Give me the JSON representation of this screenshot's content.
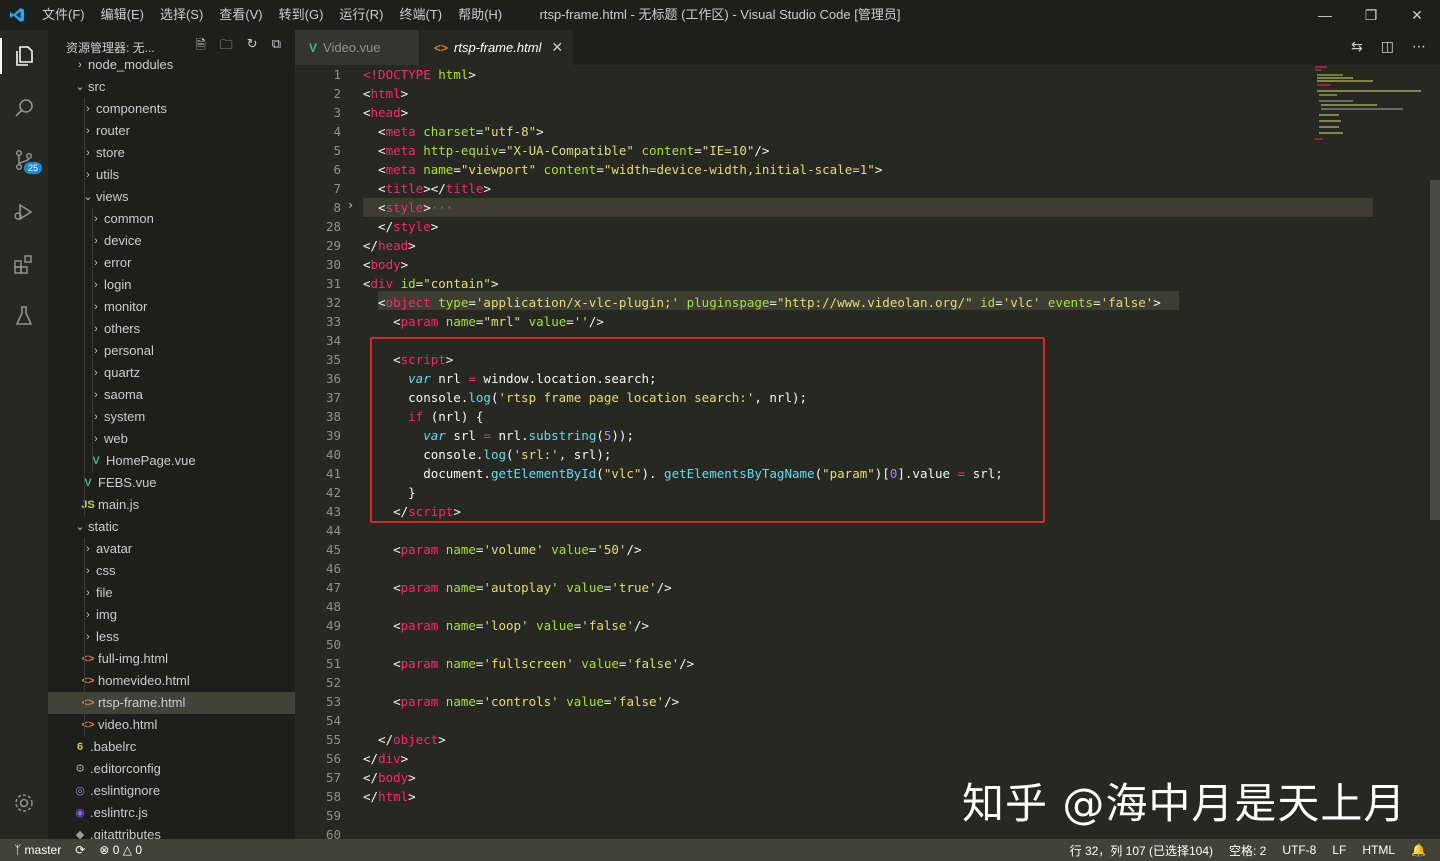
{
  "titlebar": {
    "menu": [
      "文件(F)",
      "编辑(E)",
      "选择(S)",
      "查看(V)",
      "转到(G)",
      "运行(R)",
      "终端(T)",
      "帮助(H)"
    ],
    "title": "rtsp-frame.html - 无标题 (工作区) - Visual Studio Code [管理员]"
  },
  "activity_bar": {
    "scm_badge": "25"
  },
  "sidebar": {
    "title": "资源管理器: 无...",
    "items": [
      {
        "label": "node_modules",
        "indent": 1,
        "type": "folder",
        "open": false
      },
      {
        "label": "src",
        "indent": 1,
        "type": "folder",
        "open": true
      },
      {
        "label": "components",
        "indent": 2,
        "type": "folder",
        "open": false
      },
      {
        "label": "router",
        "indent": 2,
        "type": "folder",
        "open": false
      },
      {
        "label": "store",
        "indent": 2,
        "type": "folder",
        "open": false
      },
      {
        "label": "utils",
        "indent": 2,
        "type": "folder",
        "open": false
      },
      {
        "label": "views",
        "indent": 2,
        "type": "folder",
        "open": true
      },
      {
        "label": "common",
        "indent": 3,
        "type": "folder",
        "open": false
      },
      {
        "label": "device",
        "indent": 3,
        "type": "folder",
        "open": false
      },
      {
        "label": "error",
        "indent": 3,
        "type": "folder",
        "open": false
      },
      {
        "label": "login",
        "indent": 3,
        "type": "folder",
        "open": false
      },
      {
        "label": "monitor",
        "indent": 3,
        "type": "folder",
        "open": false
      },
      {
        "label": "others",
        "indent": 3,
        "type": "folder",
        "open": false
      },
      {
        "label": "personal",
        "indent": 3,
        "type": "folder",
        "open": false
      },
      {
        "label": "quartz",
        "indent": 3,
        "type": "folder",
        "open": false
      },
      {
        "label": "saoma",
        "indent": 3,
        "type": "folder",
        "open": false
      },
      {
        "label": "system",
        "indent": 3,
        "type": "folder",
        "open": false
      },
      {
        "label": "web",
        "indent": 3,
        "type": "folder",
        "open": false
      },
      {
        "label": "HomePage.vue",
        "indent": 3,
        "type": "vue"
      },
      {
        "label": "FEBS.vue",
        "indent": 2,
        "type": "vue"
      },
      {
        "label": "main.js",
        "indent": 2,
        "type": "js"
      },
      {
        "label": "static",
        "indent": 1,
        "type": "folder",
        "open": true
      },
      {
        "label": "avatar",
        "indent": 2,
        "type": "folder",
        "open": false
      },
      {
        "label": "css",
        "indent": 2,
        "type": "folder",
        "open": false
      },
      {
        "label": "file",
        "indent": 2,
        "type": "folder",
        "open": false
      },
      {
        "label": "img",
        "indent": 2,
        "type": "folder",
        "open": false
      },
      {
        "label": "less",
        "indent": 2,
        "type": "folder",
        "open": false
      },
      {
        "label": "full-img.html",
        "indent": 2,
        "type": "html"
      },
      {
        "label": "homevideo.html",
        "indent": 2,
        "type": "html"
      },
      {
        "label": "rtsp-frame.html",
        "indent": 2,
        "type": "html",
        "selected": true
      },
      {
        "label": "video.html",
        "indent": 2,
        "type": "html"
      },
      {
        "label": ".babelrc",
        "indent": 1,
        "type": "babel"
      },
      {
        "label": ".editorconfig",
        "indent": 1,
        "type": "gear"
      },
      {
        "label": ".eslintignore",
        "indent": 1,
        "type": "eslint"
      },
      {
        "label": ".eslintrc.js",
        "indent": 1,
        "type": "eslintjs"
      },
      {
        "label": ".gitattributes",
        "indent": 1,
        "type": "git"
      }
    ]
  },
  "tabs": [
    {
      "label": "Video.vue",
      "type": "vue",
      "active": false
    },
    {
      "label": "rtsp-frame.html",
      "type": "html",
      "active": true
    }
  ],
  "editor": {
    "line_numbers": [
      "1",
      "2",
      "3",
      "4",
      "5",
      "6",
      "7",
      "8",
      "28",
      "29",
      "30",
      "31",
      "32",
      "33",
      "34",
      "35",
      "36",
      "37",
      "38",
      "39",
      "40",
      "41",
      "42",
      "43",
      "44",
      "45",
      "46",
      "47",
      "48",
      "49",
      "50",
      "51",
      "52",
      "53",
      "54",
      "55",
      "56",
      "57",
      "58",
      "59",
      "60"
    ],
    "lines": [
      [
        [
          "k",
          "<!DOCTYPE"
        ],
        [
          "a",
          " html"
        ],
        [
          "",
          "&gt;"
        ]
      ],
      [
        [
          "",
          "&lt;"
        ],
        [
          "k",
          "html"
        ],
        [
          "",
          "&gt;"
        ]
      ],
      [
        [
          "",
          "&lt;"
        ],
        [
          "k",
          "head"
        ],
        [
          "",
          "&gt;"
        ]
      ],
      [
        [
          "",
          "  &lt;"
        ],
        [
          "k",
          "meta"
        ],
        [
          "a",
          " charset"
        ],
        [
          "",
          "="
        ],
        [
          "s",
          "\"utf-8\""
        ],
        [
          "",
          "&gt;"
        ]
      ],
      [
        [
          "",
          "  &lt;"
        ],
        [
          "k",
          "meta"
        ],
        [
          "a",
          " http-equiv"
        ],
        [
          "",
          "="
        ],
        [
          "s",
          "\"X-UA-Compatible\""
        ],
        [
          "a",
          " content"
        ],
        [
          "",
          "="
        ],
        [
          "s",
          "\"IE=10\""
        ],
        [
          "",
          "/&gt;"
        ]
      ],
      [
        [
          "",
          "  &lt;"
        ],
        [
          "k",
          "meta"
        ],
        [
          "a",
          " name"
        ],
        [
          "",
          "="
        ],
        [
          "s",
          "\"viewport\""
        ],
        [
          "a",
          " content"
        ],
        [
          "",
          "="
        ],
        [
          "s",
          "\"width=device-width,initial-scale=1\""
        ],
        [
          "",
          "&gt;"
        ]
      ],
      [
        [
          "",
          "  &lt;"
        ],
        [
          "k",
          "title"
        ],
        [
          "",
          "&gt;&lt;/"
        ],
        [
          "k",
          "title"
        ],
        [
          "",
          "&gt;"
        ]
      ],
      [
        [
          "",
          "  &lt;"
        ],
        [
          "k",
          "style"
        ],
        [
          "",
          "&gt;"
        ],
        [
          "d",
          "···"
        ]
      ],
      [
        [
          "",
          "  &lt;/"
        ],
        [
          "k",
          "style"
        ],
        [
          "",
          "&gt;"
        ]
      ],
      [
        [
          "",
          "&lt;/"
        ],
        [
          "k",
          "head"
        ],
        [
          "",
          "&gt;"
        ]
      ],
      [
        [
          "",
          "&lt;"
        ],
        [
          "k",
          "body"
        ],
        [
          "",
          "&gt;"
        ]
      ],
      [
        [
          "",
          "&lt;"
        ],
        [
          "k",
          "div"
        ],
        [
          "a",
          " id"
        ],
        [
          "",
          "="
        ],
        [
          "s",
          "\"contain\""
        ],
        [
          "",
          "&gt;"
        ]
      ],
      [
        [
          "",
          "  &lt;"
        ],
        [
          "k",
          "object"
        ],
        [
          "a",
          " type"
        ],
        [
          "",
          "="
        ],
        [
          "s",
          "'application/x-vlc-plugin;'"
        ],
        [
          "a",
          " pluginspage"
        ],
        [
          "",
          "="
        ],
        [
          "s",
          "\"http://www.videolan.org/\""
        ],
        [
          "a",
          " id"
        ],
        [
          "",
          "="
        ],
        [
          "s",
          "'vlc'"
        ],
        [
          "a",
          " events"
        ],
        [
          "",
          "="
        ],
        [
          "s",
          "'false'"
        ],
        [
          "",
          "&gt;"
        ]
      ],
      [
        [
          "",
          "    &lt;"
        ],
        [
          "k",
          "param"
        ],
        [
          "a",
          " name"
        ],
        [
          "",
          "="
        ],
        [
          "s",
          "\"mrl\""
        ],
        [
          "a",
          " value"
        ],
        [
          "",
          "="
        ],
        [
          "s",
          "''"
        ],
        [
          "",
          "/&gt;"
        ]
      ],
      [],
      [
        [
          "",
          "    &lt;"
        ],
        [
          "k",
          "script"
        ],
        [
          "",
          "&gt;"
        ]
      ],
      [
        [
          "",
          "      "
        ],
        [
          "v",
          "var"
        ],
        [
          "",
          " nrl "
        ],
        [
          "k",
          "="
        ],
        [
          "",
          " window.location.search;"
        ]
      ],
      [
        [
          "",
          "      console."
        ],
        [
          "f",
          "log"
        ],
        [
          "",
          "("
        ],
        [
          "s",
          "'rtsp frame page location search:'"
        ],
        [
          "",
          ", nrl);"
        ]
      ],
      [
        [
          "",
          "      "
        ],
        [
          "k",
          "if"
        ],
        [
          "",
          " (nrl) {"
        ]
      ],
      [
        [
          "",
          "        "
        ],
        [
          "v",
          "var"
        ],
        [
          "",
          " srl "
        ],
        [
          "k",
          "="
        ],
        [
          "",
          " nrl."
        ],
        [
          "f",
          "substring"
        ],
        [
          "",
          "("
        ],
        [
          "n",
          "5"
        ],
        [
          "",
          "));"
        ]
      ],
      [
        [
          "",
          "        console."
        ],
        [
          "f",
          "log"
        ],
        [
          "",
          "("
        ],
        [
          "s",
          "'srl:'"
        ],
        [
          "",
          ", srl);"
        ]
      ],
      [
        [
          "",
          "        document."
        ],
        [
          "f",
          "getElementById"
        ],
        [
          "",
          "("
        ],
        [
          "s",
          "\"vlc\""
        ],
        [
          "",
          "). "
        ],
        [
          "f",
          "getElementsByTagName"
        ],
        [
          "",
          "("
        ],
        [
          "s",
          "\"param\""
        ],
        [
          "",
          ")["
        ],
        [
          "n",
          "0"
        ],
        [
          "",
          "].value "
        ],
        [
          "k",
          "="
        ],
        [
          "",
          " srl;"
        ]
      ],
      [
        [
          "",
          "      }"
        ]
      ],
      [
        [
          "",
          "    &lt;/"
        ],
        [
          "k",
          "script"
        ],
        [
          "",
          "&gt;"
        ]
      ],
      [],
      [
        [
          "",
          "    &lt;"
        ],
        [
          "k",
          "param"
        ],
        [
          "a",
          " name"
        ],
        [
          "",
          "="
        ],
        [
          "s",
          "'volume'"
        ],
        [
          "a",
          " value"
        ],
        [
          "",
          "="
        ],
        [
          "s",
          "'50'"
        ],
        [
          "",
          "/&gt;"
        ]
      ],
      [],
      [
        [
          "",
          "    &lt;"
        ],
        [
          "k",
          "param"
        ],
        [
          "a",
          " name"
        ],
        [
          "",
          "="
        ],
        [
          "s",
          "'autoplay'"
        ],
        [
          "a",
          " value"
        ],
        [
          "",
          "="
        ],
        [
          "s",
          "'true'"
        ],
        [
          "",
          "/&gt;"
        ]
      ],
      [],
      [
        [
          "",
          "    &lt;"
        ],
        [
          "k",
          "param"
        ],
        [
          "a",
          " name"
        ],
        [
          "",
          "="
        ],
        [
          "s",
          "'loop'"
        ],
        [
          "a",
          " value"
        ],
        [
          "",
          "="
        ],
        [
          "s",
          "'false'"
        ],
        [
          "",
          "/&gt;"
        ]
      ],
      [],
      [
        [
          "",
          "    &lt;"
        ],
        [
          "k",
          "param"
        ],
        [
          "a",
          " name"
        ],
        [
          "",
          "="
        ],
        [
          "s",
          "'fullscreen'"
        ],
        [
          "a",
          " value"
        ],
        [
          "",
          "="
        ],
        [
          "s",
          "'false'"
        ],
        [
          "",
          "/&gt;"
        ]
      ],
      [],
      [
        [
          "",
          "    &lt;"
        ],
        [
          "k",
          "param"
        ],
        [
          "a",
          " name"
        ],
        [
          "",
          "="
        ],
        [
          "s",
          "'controls'"
        ],
        [
          "a",
          " value"
        ],
        [
          "",
          "="
        ],
        [
          "s",
          "'false'"
        ],
        [
          "",
          "/&gt;"
        ]
      ],
      [],
      [
        [
          "",
          "  &lt;/"
        ],
        [
          "k",
          "object"
        ],
        [
          "",
          "&gt;"
        ]
      ],
      [
        [
          "",
          "&lt;/"
        ],
        [
          "k",
          "div"
        ],
        [
          "",
          "&gt;"
        ]
      ],
      [
        [
          "",
          "&lt;/"
        ],
        [
          "k",
          "body"
        ],
        [
          "",
          "&gt;"
        ]
      ],
      [
        [
          "",
          "&lt;/"
        ],
        [
          "k",
          "html"
        ],
        [
          "",
          "&gt;"
        ]
      ],
      [],
      []
    ]
  },
  "watermark": "知乎 @海中月是天上月",
  "statusbar": {
    "branch": "master",
    "errors": "0",
    "warnings": "0",
    "position": "行 32，列 107 (已选择104)",
    "spaces": "空格: 2",
    "encoding": "UTF-8",
    "eol": "LF",
    "language": "HTML"
  },
  "colors": {
    "keyword": "#f92672",
    "attr": "#a6e22e",
    "string": "#e6db74",
    "func": "#66d9ef",
    "number": "#ae81ff",
    "redbox": "#e02424"
  }
}
